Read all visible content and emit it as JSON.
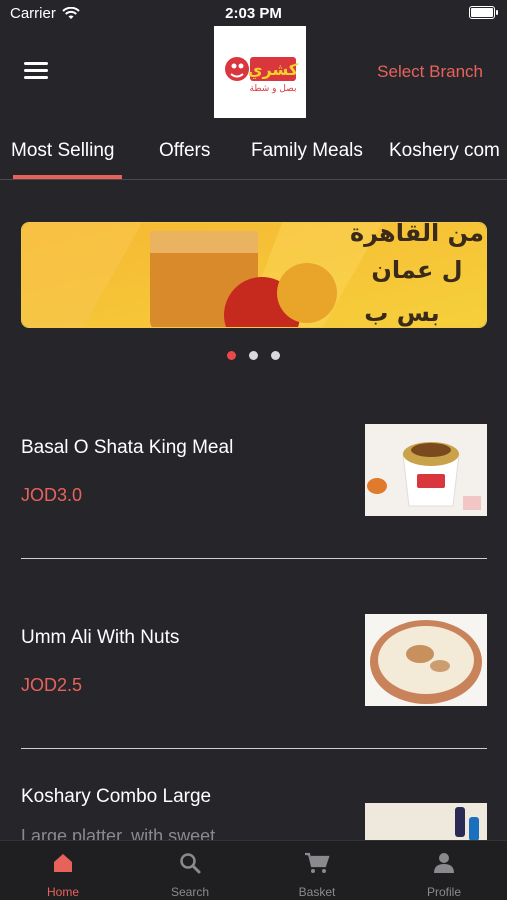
{
  "status_bar": {
    "carrier": "Carrier",
    "time": "2:03 PM"
  },
  "header": {
    "select_branch": "Select Branch",
    "logo_text": "كشري",
    "logo_subtext": "بصل و شطة"
  },
  "tabs": [
    {
      "label": "Most Selling"
    },
    {
      "label": "Offers"
    },
    {
      "label": "Family Meals"
    },
    {
      "label": "Koshery com"
    }
  ],
  "banner": {
    "line1": "من القاهرة",
    "line2": "ل عمان",
    "line3": "بس ب"
  },
  "items": [
    {
      "name": "Basal O Shata King Meal",
      "price": "JOD3.0",
      "image": "koshary-bowl-photo"
    },
    {
      "name": "Umm Ali With Nuts",
      "price": "JOD2.5",
      "image": "umm-ali-dish-photo"
    },
    {
      "name": "Koshary Combo Large",
      "description": "Large platter, with sweet",
      "image": "combo-photo"
    }
  ],
  "tabbar": [
    {
      "label": "Home",
      "icon": "home-icon"
    },
    {
      "label": "Search",
      "icon": "search-icon"
    },
    {
      "label": "Basket",
      "icon": "cart-icon"
    },
    {
      "label": "Profile",
      "icon": "profile-icon"
    }
  ],
  "colors": {
    "background": "#26262a",
    "accent": "#e8625c",
    "tabbar": "#1f1f22"
  }
}
